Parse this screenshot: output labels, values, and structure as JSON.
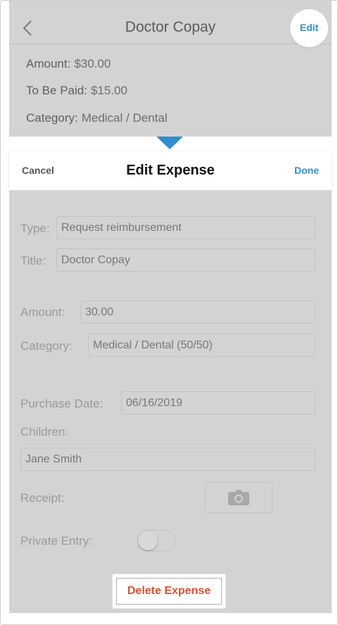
{
  "nav": {
    "title": "Doctor Copay",
    "edit_label": "Edit"
  },
  "details": [
    {
      "label": "Amount:",
      "value": "$30.00"
    },
    {
      "label": "To Be Paid:",
      "value": "$15.00"
    },
    {
      "label": "Category:",
      "value": "Medical / Dental"
    }
  ],
  "sheet": {
    "cancel_label": "Cancel",
    "title": "Edit Expense",
    "done_label": "Done"
  },
  "form": {
    "type": {
      "label": "Type:",
      "value": "Request reimbursement"
    },
    "title": {
      "label": "Title:",
      "value": "Doctor Copay"
    },
    "amount": {
      "label": "Amount:",
      "value": "30.00"
    },
    "category": {
      "label": "Category:",
      "value": "Medical / Dental (50/50)"
    },
    "purchase_date": {
      "label": "Purchase Date:",
      "value": "06/16/2019"
    },
    "children": {
      "label": "Children:",
      "value": "Jane Smith"
    },
    "receipt": {
      "label": "Receipt:"
    },
    "private_entry": {
      "label": "Private Entry:",
      "on": false
    },
    "delete_label": "Delete Expense"
  },
  "colors": {
    "accent": "#2f8fcf",
    "danger": "#d9522b",
    "overlay": "#d3d3d3"
  }
}
